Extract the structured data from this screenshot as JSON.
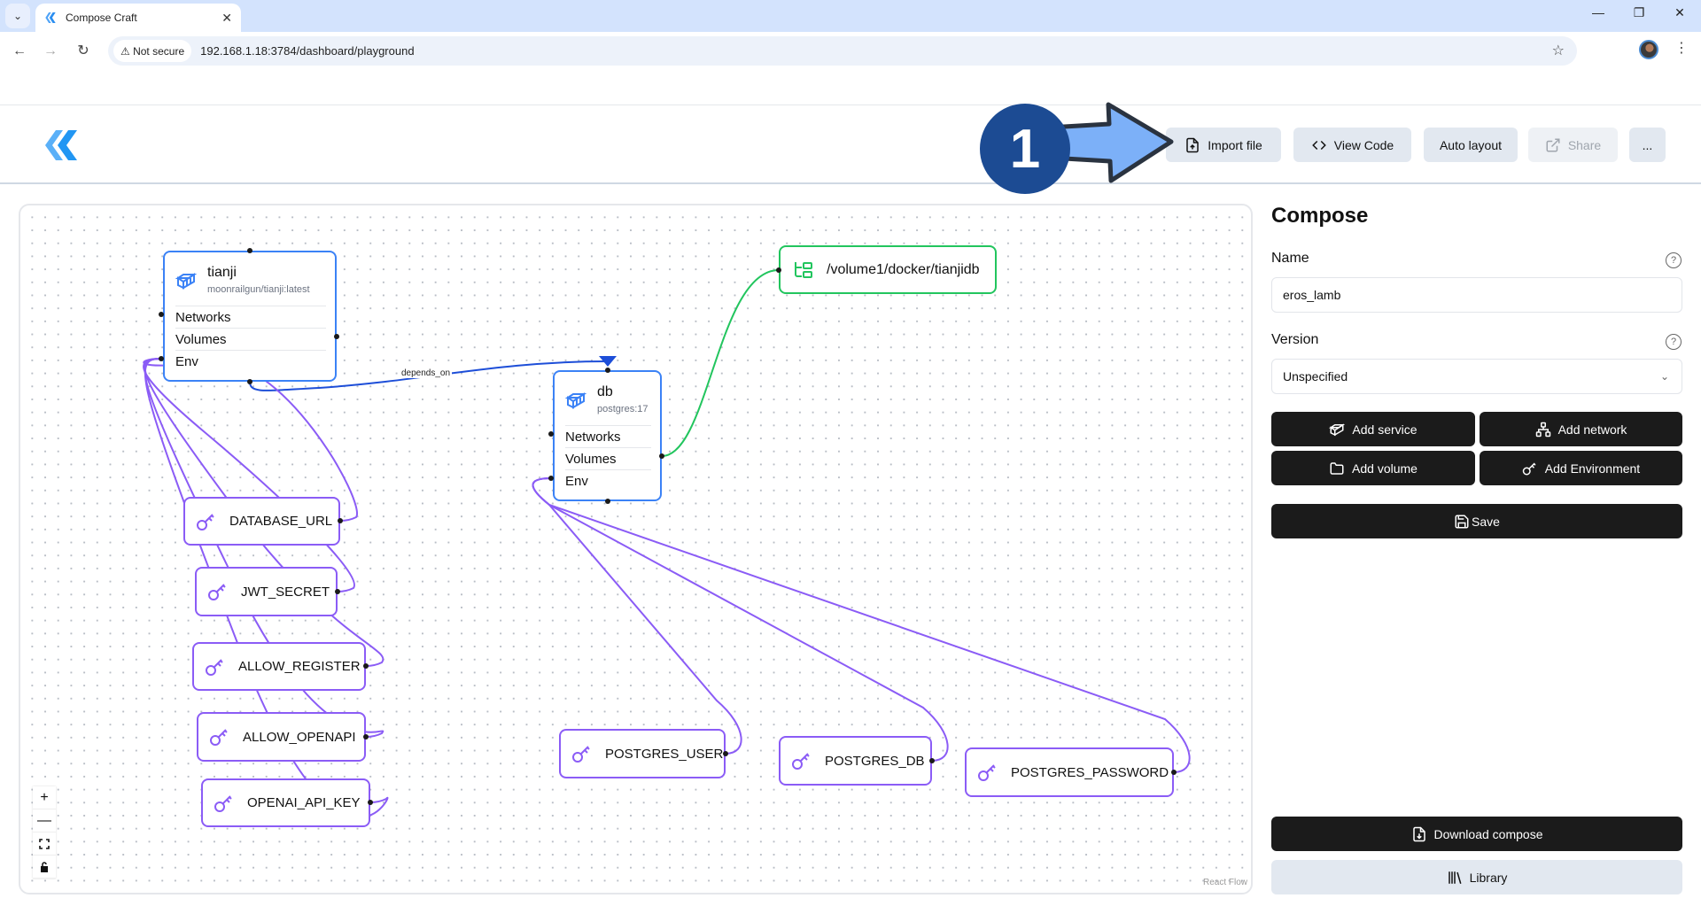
{
  "browser": {
    "tab_title": "Compose Craft",
    "security_label": "Not secure",
    "url": "192.168.1.18:3784/dashboard/playground",
    "controls": {
      "minimize": "—",
      "restore": "❐",
      "close": "✕"
    }
  },
  "header": {
    "buttons": [
      {
        "label": "Import file",
        "icon": "file-upload-icon",
        "disabled": false
      },
      {
        "label": "View Code",
        "icon": "code-icon",
        "disabled": false
      },
      {
        "label": "Auto layout",
        "icon": null,
        "disabled": false
      },
      {
        "label": "Share",
        "icon": "external-link-icon",
        "disabled": true
      },
      {
        "label": "...",
        "icon": null,
        "disabled": false
      }
    ]
  },
  "annotation": {
    "step_number": "1"
  },
  "canvas": {
    "services": [
      {
        "name": "tianji",
        "image": "moonrailgun/tianji:latest",
        "sections": [
          "Networks",
          "Volumes",
          "Env"
        ]
      },
      {
        "name": "db",
        "image": "postgres:17",
        "sections": [
          "Networks",
          "Volumes",
          "Env"
        ]
      }
    ],
    "volumes": [
      {
        "path": "/volume1/docker/tianjidb"
      }
    ],
    "env_vars": [
      "DATABASE_URL",
      "JWT_SECRET",
      "ALLOW_REGISTER",
      "ALLOW_OPENAPI",
      "OPENAI_API_KEY",
      "POSTGRES_USER",
      "POSTGRES_DB",
      "POSTGRES_PASSWORD"
    ],
    "edge_labels": {
      "depends_on": "depends_on"
    },
    "controls": {
      "zoom_in": "+",
      "zoom_out": "—",
      "fit": "⛶",
      "lock": "🔒"
    },
    "attribution": "React Flow",
    "colors": {
      "service": "#3b82f6",
      "volume": "#22c55e",
      "env": "#8b5cf6",
      "depends_edge": "#1d4ed8"
    }
  },
  "panel": {
    "title": "Compose",
    "name_label": "Name",
    "name_value": "eros_lamb",
    "version_label": "Version",
    "version_value": "Unspecified",
    "help": "?",
    "add_service": "Add service",
    "add_network": "Add network",
    "add_volume": "Add volume",
    "add_environment": "Add Environment",
    "save": "Save",
    "download": "Download compose",
    "library": "Library"
  }
}
